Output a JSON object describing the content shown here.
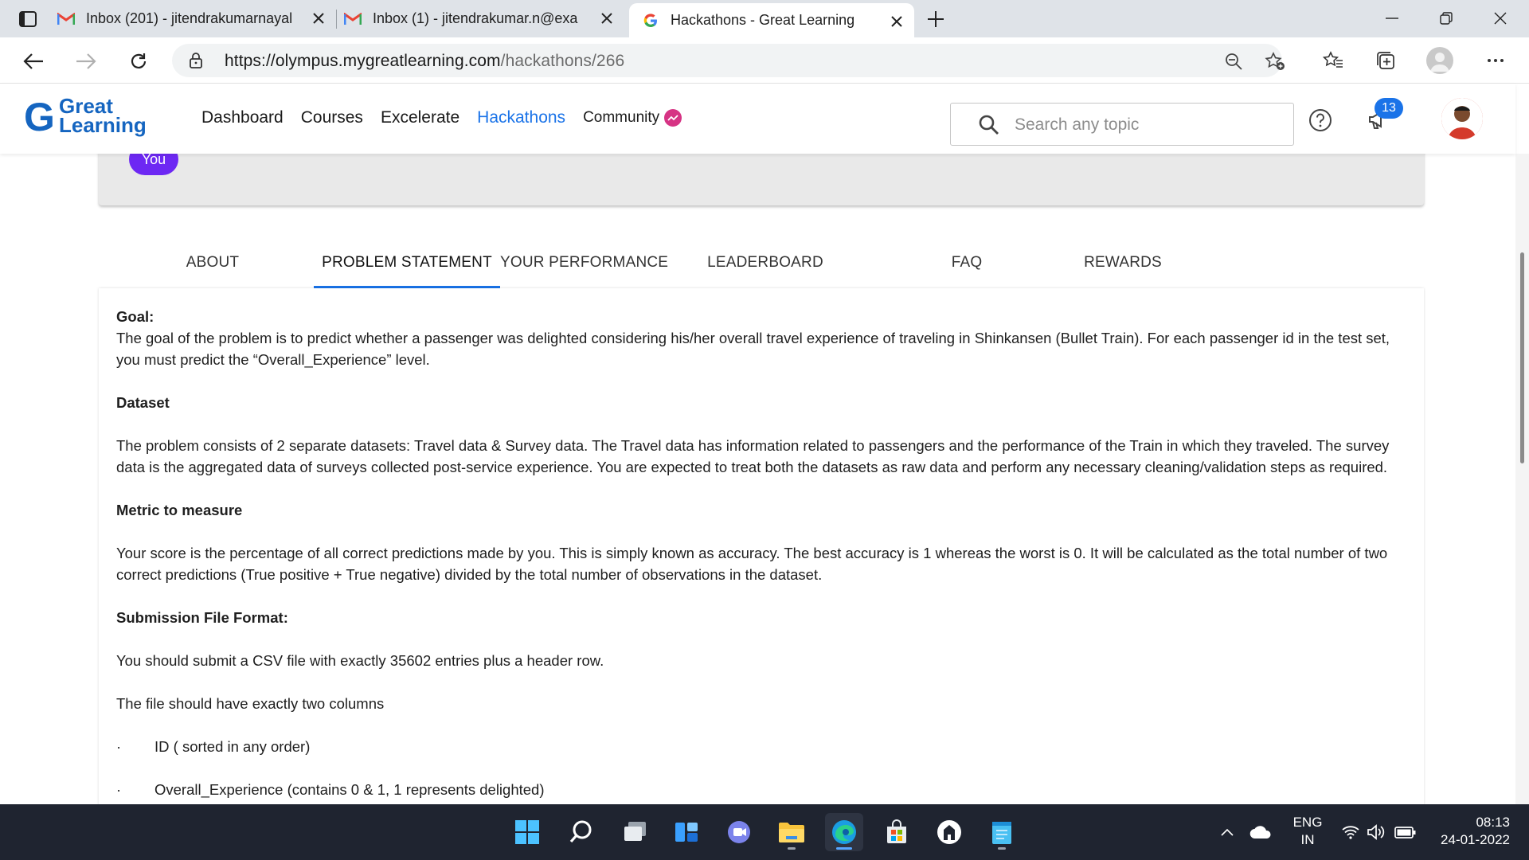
{
  "browser": {
    "tabs": [
      {
        "title": "Inbox (201) - jitendrakumarnayal",
        "icon": "gmail-icon",
        "active": false
      },
      {
        "title": "Inbox (1) - jitendrakumar.n@exa",
        "icon": "gmail-icon",
        "active": false
      },
      {
        "title": "Hackathons - Great Learning",
        "icon": "google-icon",
        "active": true
      }
    ],
    "url_host": "https://olympus.mygreatlearning.com",
    "url_path": "/hackathons/266"
  },
  "site": {
    "logo_line1": "Great",
    "logo_line2": "Learning",
    "logo_mark": "G",
    "nav": {
      "dashboard": "Dashboard",
      "courses": "Courses",
      "excelerate": "Excelerate",
      "hackathons": "Hackathons",
      "community": "Community"
    },
    "search_placeholder": "Search any topic",
    "notification_count": "13",
    "accent_color": "#1a73e8"
  },
  "banner": {
    "you_label": "You"
  },
  "page_tabs": {
    "about": "ABOUT",
    "problem": "PROBLEM STATEMENT",
    "performance": "YOUR PERFORMANCE",
    "leaderboard": "LEADERBOARD",
    "faq": "FAQ",
    "rewards": "REWARDS",
    "active": "PROBLEM STATEMENT"
  },
  "problem": {
    "goal_heading": "Goal:",
    "goal_text": "The goal of the problem is to predict whether a passenger was delighted considering his/her overall travel experience of traveling in Shinkansen (Bullet Train). For each passenger id in the test set, you must predict the “Overall_Experience” level.",
    "dataset_heading": "Dataset",
    "dataset_text": "The problem consists of 2 separate datasets: Travel data & Survey data. The Travel data has information related to passengers and the performance of the Train in which they traveled. The survey data is the aggregated data of surveys collected post-service experience. You are expected to treat both the datasets as raw data and perform any necessary cleaning/validation steps as required.",
    "metric_heading": "Metric to measure",
    "metric_text": "Your score is the percentage of all correct predictions made by you. This is simply known as accuracy. The best accuracy is 1 whereas the worst is 0. It will be calculated as the total number of two correct predictions (True positive + True negative) divided by the total number of observations in the dataset.",
    "submission_heading": "Submission File Format:",
    "submission_text": "You should submit a CSV file with exactly 35602 entries plus a header row.",
    "columns_text": "The file should have exactly two columns",
    "bullet": "·",
    "column_items": [
      "ID ( sorted in any order)",
      "Overall_Experience (contains 0 & 1, 1 represents delighted)"
    ]
  },
  "taskbar": {
    "lang_line1": "ENG",
    "lang_line2": "IN",
    "time": "08:13",
    "date": "24-01-2022"
  }
}
